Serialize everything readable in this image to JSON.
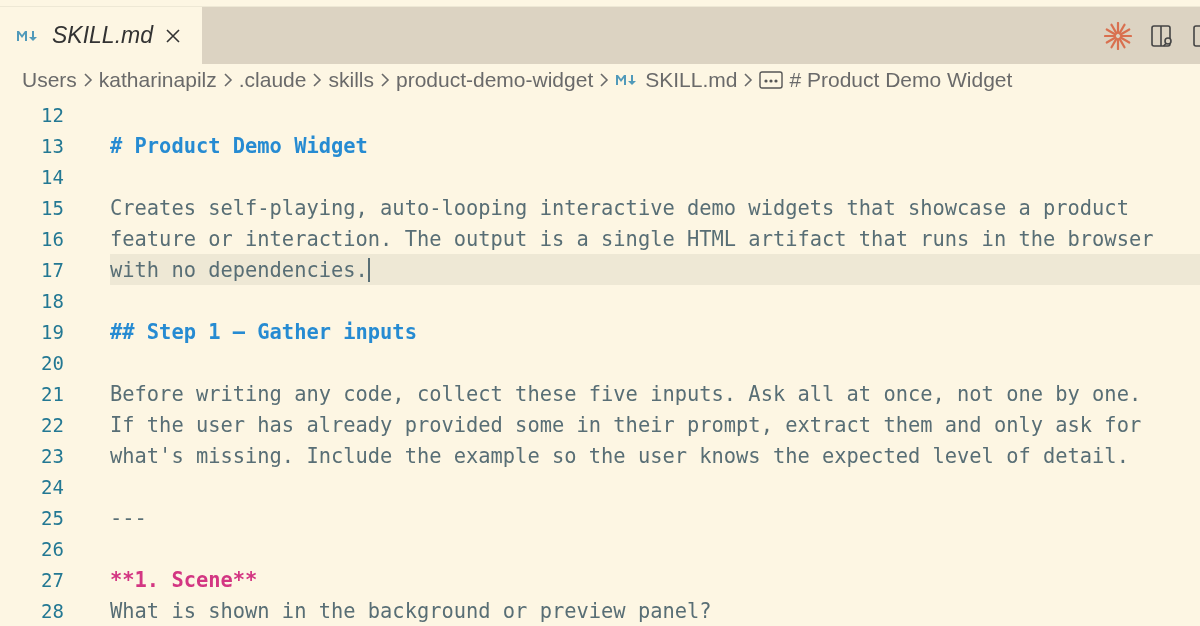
{
  "tabs": [
    {
      "label": "SKILL.md",
      "selected": true,
      "kind": "markdown"
    }
  ],
  "breadcrumb": [
    {
      "label": "Users",
      "kind": "folder"
    },
    {
      "label": "katharinapilz",
      "kind": "folder"
    },
    {
      "label": ".claude",
      "kind": "folder"
    },
    {
      "label": "skills",
      "kind": "folder"
    },
    {
      "label": "product-demo-widget",
      "kind": "folder"
    },
    {
      "label": "SKILL.md",
      "kind": "markdown"
    },
    {
      "label": "# Product Demo Widget",
      "kind": "symbol"
    }
  ],
  "lines": [
    {
      "number": "12",
      "kind": "blank",
      "current": false
    },
    {
      "number": "13",
      "kind": "heading",
      "text": "# Product Demo Widget",
      "current": false
    },
    {
      "number": "14",
      "kind": "blank",
      "current": false
    },
    {
      "number": "15",
      "kind": "text",
      "text": "Creates self-playing, auto-looping interactive demo widgets that showcase a product",
      "current": false
    },
    {
      "number": "16",
      "kind": "text",
      "text": "feature or interaction. The output is a single HTML artifact that runs in the browser",
      "current": false
    },
    {
      "number": "17",
      "kind": "text",
      "text": "with no dependencies.",
      "current": true
    },
    {
      "number": "18",
      "kind": "blank",
      "current": false
    },
    {
      "number": "19",
      "kind": "heading",
      "text": "## Step 1 — Gather inputs",
      "current": false
    },
    {
      "number": "20",
      "kind": "blank",
      "current": false
    },
    {
      "number": "21",
      "kind": "text",
      "text": "Before writing any code, collect these five inputs. Ask all at once, not one by one.",
      "current": false
    },
    {
      "number": "22",
      "kind": "text",
      "text": "If the user has already provided some in their prompt, extract them and only ask for",
      "current": false
    },
    {
      "number": "23",
      "kind": "text",
      "text": "what's missing. Include the example so the user knows the expected level of detail.",
      "current": false
    },
    {
      "number": "24",
      "kind": "blank",
      "current": false
    },
    {
      "number": "25",
      "kind": "text",
      "text": "---",
      "current": false
    },
    {
      "number": "26",
      "kind": "blank",
      "current": false
    },
    {
      "number": "27",
      "kind": "bold",
      "text": "**1. Scene**",
      "current": false
    },
    {
      "number": "28",
      "kind": "text",
      "text": "What is shown in the background or preview panel?",
      "current": false
    }
  ]
}
